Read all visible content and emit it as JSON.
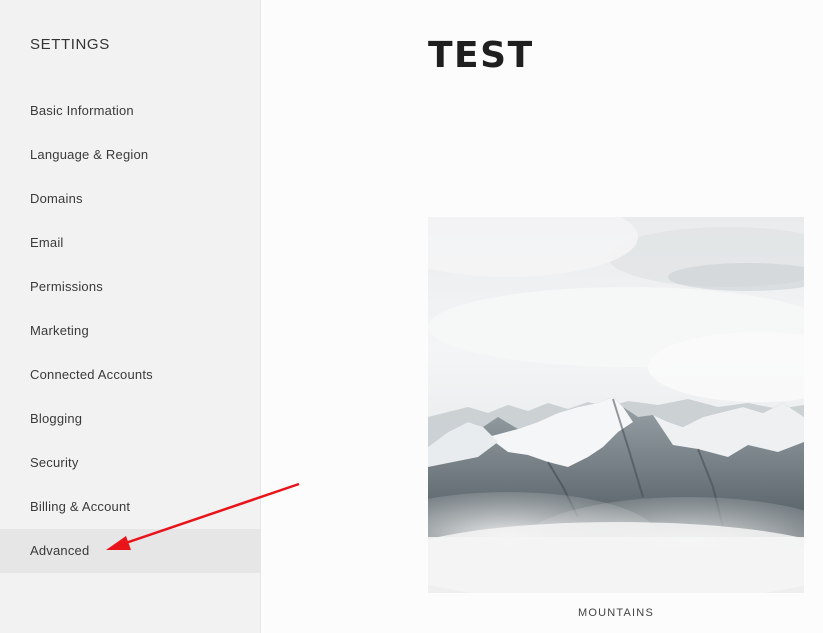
{
  "sidebar": {
    "title": "SETTINGS",
    "items": [
      {
        "label": "Basic Information"
      },
      {
        "label": "Language & Region"
      },
      {
        "label": "Domains"
      },
      {
        "label": "Email"
      },
      {
        "label": "Permissions"
      },
      {
        "label": "Marketing"
      },
      {
        "label": "Connected Accounts"
      },
      {
        "label": "Blogging"
      },
      {
        "label": "Security"
      },
      {
        "label": "Billing & Account"
      },
      {
        "label": "Advanced"
      }
    ],
    "active_item": "Advanced"
  },
  "main": {
    "heading": "TEST",
    "image": {
      "subject": "snowy mountain range above clouds"
    },
    "caption": "MOUNTAINS"
  },
  "annotation": {
    "arrow_color": "#e8141a",
    "points_to": "Advanced"
  }
}
